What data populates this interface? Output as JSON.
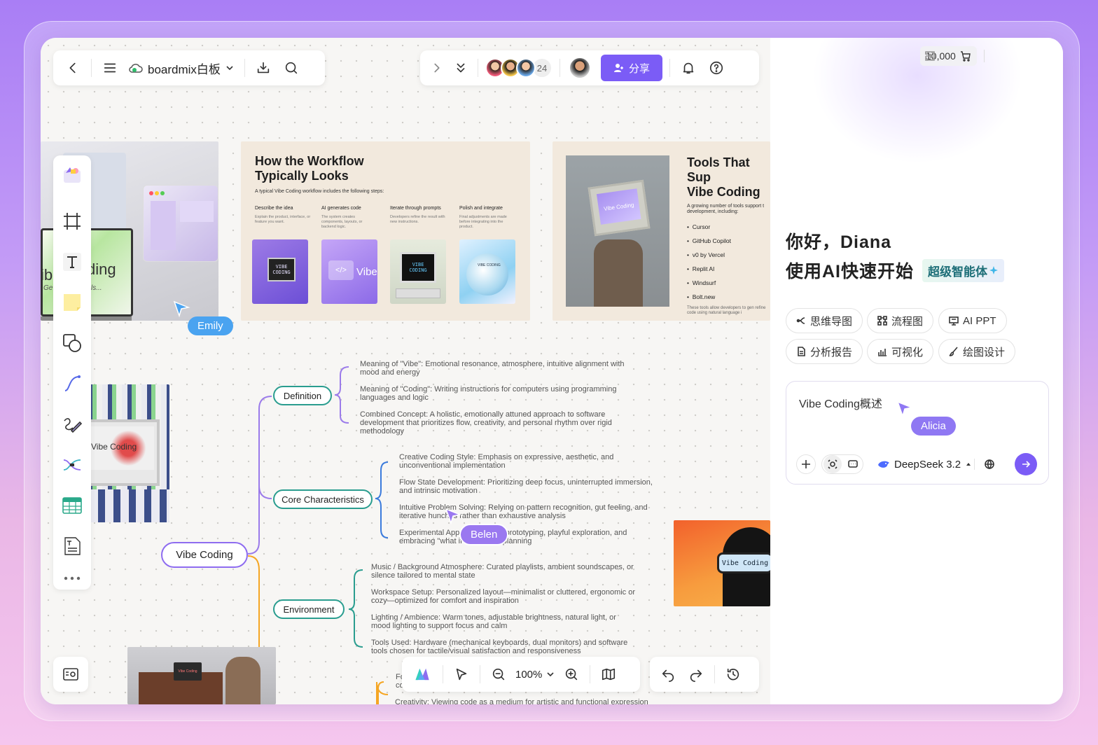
{
  "header": {
    "board_name": "boardmix白板",
    "collaborator_count": "24",
    "share_label": "分享"
  },
  "ai_panel": {
    "credits": "10,000",
    "greeting_line1": "你好，Diana",
    "greeting_line2": "使用AI快速开始",
    "agent_badge": "超级智能体",
    "chips": [
      "思维导图",
      "流程图",
      "AI PPT",
      "分析报告",
      "可视化",
      "绘图设计"
    ],
    "input_value": "Vibe Coding概述",
    "model_name": "DeepSeek 3.2"
  },
  "slides": {
    "left_card_big_text": "ding",
    "left_card_big_prefix": "ib",
    "left_card_small": "ls...",
    "left_card_small_prefix": "Ge",
    "workflow": {
      "title_line1": "How the Workflow",
      "title_line2": "Typically Looks",
      "subtitle": "A typical Vibe Coding workflow includes the following steps:",
      "steps": [
        {
          "title": "Describe the idea",
          "desc": "Explain the product, interface, or feature you want."
        },
        {
          "title": "AI generates code",
          "desc": "The system creates components, layouts, or backend logic."
        },
        {
          "title": "Iterate through prompts",
          "desc": "Developers refine the result with new instructions."
        },
        {
          "title": "Polish and integrate",
          "desc": "Final adjustments are made before integrating into the product."
        }
      ],
      "thumb_labels": [
        "VIBE CODING",
        "Vibe",
        "VIBE CODING",
        "VIBE CODING"
      ]
    },
    "tools": {
      "title_line1": "Tools That Sup",
      "title_line2": "Vibe Coding",
      "subtitle": "A growing number of tools support t development, including:",
      "items": [
        "Cursor",
        "GitHub Copilot",
        "v0 by Vercel",
        "Replit AI",
        "Windsurf",
        "Bolt.new"
      ],
      "footer": "These tools allow developers to gen refine code using natural language i",
      "image_label": "Vibe Coding"
    },
    "monitor_label": "Vibe Coding",
    "goggles_label": "Vibe Coding",
    "laptop_label": "Vibe Coding"
  },
  "mindmap": {
    "root": "Vibe Coding",
    "branches": [
      {
        "label": "Definition",
        "items": [
          "Meaning of \"Vibe\": Emotional resonance, atmosphere, intuitive alignment with mood and energy",
          "Meaning of \"Coding\": Writing instructions for computers using programming languages and logic",
          "Combined Concept: A holistic, emotionally attuned approach to software development that prioritizes flow, creativity, and personal rhythm over rigid methodology"
        ]
      },
      {
        "label": "Core Characteristics",
        "items": [
          "Creative Coding Style: Emphasis on expressive, aesthetic, and unconventional implementation",
          "Flow State Development: Prioritizing deep focus, uninterrupted immersion, and intrinsic motivation",
          "Intuitive Problem Solving: Relying on pattern recognition, gut feeling, and iterative hunches rather than exhaustive analysis",
          "Experimental Approach: Rapid prototyping, playful exploration, and embracing \"what if\" over strict planning"
        ]
      },
      {
        "label": "Environment",
        "items": [
          "Music / Background Atmosphere: Curated playlists, ambient soundscapes, or silence tailored to mental state",
          "Workspace Setup: Personalized layout—minimalist or cluttered, ergonomic or cozy—optimized for comfort and inspiration",
          "Lighting / Ambience: Warm tones, adjustable brightness, natural light, or mood lighting to support focus and calm",
          "Tools Used: Hardware (mechanical keyboards, dual monitors) and software tools chosen for tactile/visual satisfaction and responsiveness"
        ]
      }
    ],
    "partial_bottom_line1_a": "Fo",
    "partial_bottom_line1_b": "nt",
    "partial_bottom_line2_a": "co",
    "partial_bottom_line2_b": "n",
    "bottom_line": "Creativity: Viewing code as a medium for artistic and functional expression"
  },
  "cursors": [
    {
      "name": "Emily",
      "color": "#4aa3f0"
    },
    {
      "name": "Belen",
      "color": "#9a78f0"
    },
    {
      "name": "Alicia",
      "color": "#8f78f3"
    }
  ],
  "bottom_toolbar": {
    "zoom": "100%"
  },
  "colors": {
    "accent": "#7b5cf6",
    "mindmap_teal": "#2a9d8f",
    "root_purple": "#8e6cf0",
    "branch_orange": "#f5a623",
    "branch_blue": "#3b7bdc"
  }
}
